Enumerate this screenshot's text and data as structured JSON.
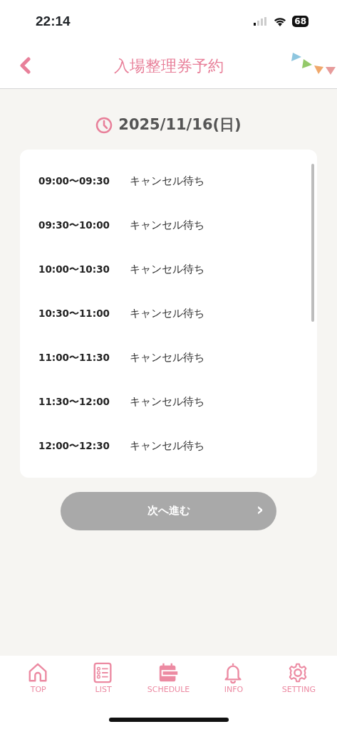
{
  "status_bar": {
    "time": "22:14",
    "battery": "68"
  },
  "header": {
    "title": "入場整理券予約"
  },
  "date": "2025/11/16(日)",
  "slots": [
    {
      "time": "09:00〜09:30",
      "status": "キャンセル待ち"
    },
    {
      "time": "09:30〜10:00",
      "status": "キャンセル待ち"
    },
    {
      "time": "10:00〜10:30",
      "status": "キャンセル待ち"
    },
    {
      "time": "10:30〜11:00",
      "status": "キャンセル待ち"
    },
    {
      "time": "11:00〜11:30",
      "status": "キャンセル待ち"
    },
    {
      "time": "11:30〜12:00",
      "status": "キャンセル待ち"
    },
    {
      "time": "12:00〜12:30",
      "status": "キャンセル待ち"
    }
  ],
  "next_button": {
    "label": "次へ進む",
    "arrow": "›",
    "disabled": true
  },
  "tab_bar": [
    {
      "kind": "home",
      "label": "TOP"
    },
    {
      "kind": "list",
      "label": "LIST"
    },
    {
      "kind": "schedule",
      "label": "SCHEDULE"
    },
    {
      "kind": "bell",
      "label": "INFO"
    },
    {
      "kind": "gear",
      "label": "SETTING"
    }
  ]
}
